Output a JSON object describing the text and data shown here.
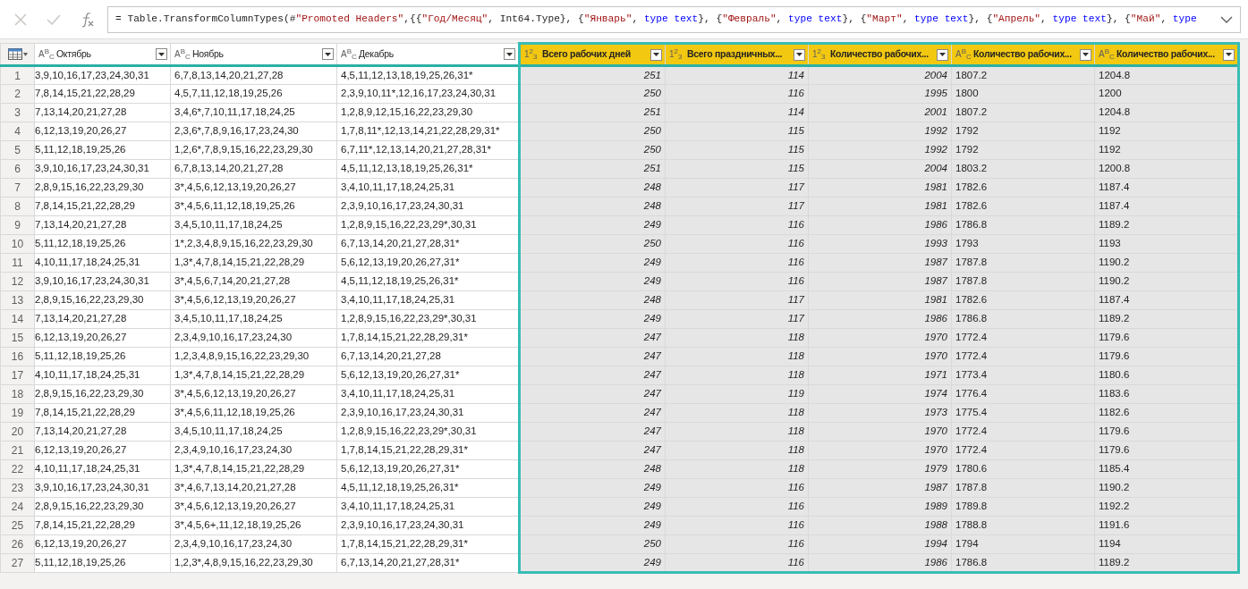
{
  "formula_bar": {
    "formula": [
      {
        "kind": "plain",
        "text": "= Table.TransformColumnTypes(#"
      },
      {
        "kind": "string",
        "text": "\"Promoted Headers\""
      },
      {
        "kind": "plain",
        "text": ",{{"
      },
      {
        "kind": "string",
        "text": "\"Год/Месяц\""
      },
      {
        "kind": "plain",
        "text": ", Int64.Type}, {"
      },
      {
        "kind": "string",
        "text": "\"Январь\""
      },
      {
        "kind": "plain",
        "text": ", "
      },
      {
        "kind": "keyword",
        "text": "type text"
      },
      {
        "kind": "plain",
        "text": "}, {"
      },
      {
        "kind": "string",
        "text": "\"Февраль\""
      },
      {
        "kind": "plain",
        "text": ", "
      },
      {
        "kind": "keyword",
        "text": "type text"
      },
      {
        "kind": "plain",
        "text": "}, {"
      },
      {
        "kind": "string",
        "text": "\"Март\""
      },
      {
        "kind": "plain",
        "text": ", "
      },
      {
        "kind": "keyword",
        "text": "type text"
      },
      {
        "kind": "plain",
        "text": "}, {"
      },
      {
        "kind": "string",
        "text": "\"Апрель\""
      },
      {
        "kind": "plain",
        "text": ", "
      },
      {
        "kind": "keyword",
        "text": "type text"
      },
      {
        "kind": "plain",
        "text": "}, {"
      },
      {
        "kind": "string",
        "text": "\"Май\""
      },
      {
        "kind": "plain",
        "text": ", "
      },
      {
        "kind": "keyword",
        "text": "type"
      }
    ]
  },
  "table": {
    "columns": [
      {
        "label": "Октябрь",
        "kind": "text",
        "type_label": "A$^{B}$$_{C}$",
        "selected": false
      },
      {
        "label": "Ноябрь",
        "kind": "text",
        "type_label": "A$^{B}$$_{C}$",
        "selected": false
      },
      {
        "label": "Декабрь",
        "kind": "text",
        "type_label": "A$^{B}$$_{C}$",
        "selected": false
      },
      {
        "label": "Всего рабочих дней",
        "kind": "number",
        "type_label": "1$^{2}$$_{3}$",
        "selected": true
      },
      {
        "label": "Всего праздничных...",
        "kind": "number",
        "type_label": "1$^{2}$$_{3}$",
        "selected": true
      },
      {
        "label": "Количество рабочих...",
        "kind": "number",
        "type_label": "1$^{2}$$_{3}$",
        "selected": true
      },
      {
        "label": "Количество рабочих...",
        "kind": "text",
        "type_label": "A$^{B}$$_{C}$",
        "selected": true
      },
      {
        "label": "Количество рабочих...",
        "kind": "text",
        "type_label": "A$^{B}$$_{C}$",
        "selected": true
      }
    ],
    "rows": [
      {
        "number": "1",
        "cells": [
          "3,9,10,16,17,23,24,30,31",
          "6,7,8,13,14,20,21,27,28",
          "4,5,11,12,13,18,19,25,26,31*",
          "251",
          "114",
          "2004",
          "1807.2",
          "1204.8"
        ]
      },
      {
        "number": "2",
        "cells": [
          "7,8,14,15,21,22,28,29",
          "4,5,7,11,12,18,19,25,26",
          "2,3,9,10,11*,12,16,17,23,24,30,31",
          "250",
          "116",
          "1995",
          "1800",
          "1200"
        ]
      },
      {
        "number": "3",
        "cells": [
          "7,13,14,20,21,27,28",
          "3,4,6*,7,10,11,17,18,24,25",
          "1,2,8,9,12,15,16,22,23,29,30",
          "251",
          "114",
          "2001",
          "1807.2",
          "1204.8"
        ]
      },
      {
        "number": "4",
        "cells": [
          "6,12,13,19,20,26,27",
          "2,3,6*,7,8,9,16,17,23,24,30",
          "1,7,8,11*,12,13,14,21,22,28,29,31*",
          "250",
          "115",
          "1992",
          "1792",
          "1192"
        ]
      },
      {
        "number": "5",
        "cells": [
          "5,11,12,18,19,25,26",
          "1,2,6*,7,8,9,15,16,22,23,29,30",
          "6,7,11*,12,13,14,20,21,27,28,31*",
          "250",
          "115",
          "1992",
          "1792",
          "1192"
        ]
      },
      {
        "number": "6",
        "cells": [
          "3,9,10,16,17,23,24,30,31",
          "6,7,8,13,14,20,21,27,28",
          "4,5,11,12,13,18,19,25,26,31*",
          "251",
          "115",
          "2004",
          "1803.2",
          "1200.8"
        ]
      },
      {
        "number": "7",
        "cells": [
          "2,8,9,15,16,22,23,29,30",
          "3*,4,5,6,12,13,19,20,26,27",
          "3,4,10,11,17,18,24,25,31",
          "248",
          "117",
          "1981",
          "1782.6",
          "1187.4"
        ]
      },
      {
        "number": "8",
        "cells": [
          "7,8,14,15,21,22,28,29",
          "3*,4,5,6,11,12,18,19,25,26",
          "2,3,9,10,16,17,23,24,30,31",
          "248",
          "117",
          "1981",
          "1782.6",
          "1187.4"
        ]
      },
      {
        "number": "9",
        "cells": [
          "7,13,14,20,21,27,28",
          "3,4,5,10,11,17,18,24,25",
          "1,2,8,9,15,16,22,23,29*,30,31",
          "249",
          "116",
          "1986",
          "1786.8",
          "1189.2"
        ]
      },
      {
        "number": "10",
        "cells": [
          "5,11,12,18,19,25,26",
          "1*,2,3,4,8,9,15,16,22,23,29,30",
          "6,7,13,14,20,21,27,28,31*",
          "250",
          "116",
          "1993",
          "1793",
          "1193"
        ]
      },
      {
        "number": "11",
        "cells": [
          "4,10,11,17,18,24,25,31",
          "1,3*,4,7,8,14,15,21,22,28,29",
          "5,6,12,13,19,20,26,27,31*",
          "249",
          "116",
          "1987",
          "1787.8",
          "1190.2"
        ]
      },
      {
        "number": "12",
        "cells": [
          "3,9,10,16,17,23,24,30,31",
          "3*,4,5,6,7,14,20,21,27,28",
          "4,5,11,12,18,19,25,26,31*",
          "249",
          "116",
          "1987",
          "1787.8",
          "1190.2"
        ]
      },
      {
        "number": "13",
        "cells": [
          "2,8,9,15,16,22,23,29,30",
          "3*,4,5,6,12,13,19,20,26,27",
          "3,4,10,11,17,18,24,25,31",
          "248",
          "117",
          "1981",
          "1782.6",
          "1187.4"
        ]
      },
      {
        "number": "14",
        "cells": [
          "7,13,14,20,21,27,28",
          "3,4,5,10,11,17,18,24,25",
          "1,2,8,9,15,16,22,23,29*,30,31",
          "249",
          "117",
          "1986",
          "1786.8",
          "1189.2"
        ]
      },
      {
        "number": "15",
        "cells": [
          "6,12,13,19,20,26,27",
          "2,3,4,9,10,16,17,23,24,30",
          "1,7,8,14,15,21,22,28,29,31*",
          "247",
          "118",
          "1970",
          "1772.4",
          "1179.6"
        ]
      },
      {
        "number": "16",
        "cells": [
          "5,11,12,18,19,25,26",
          "1,2,3,4,8,9,15,16,22,23,29,30",
          "6,7,13,14,20,21,27,28",
          "247",
          "118",
          "1970",
          "1772.4",
          "1179.6"
        ]
      },
      {
        "number": "17",
        "cells": [
          "4,10,11,17,18,24,25,31",
          "1,3*,4,7,8,14,15,21,22,28,29",
          "5,6,12,13,19,20,26,27,31*",
          "247",
          "118",
          "1971",
          "1773.4",
          "1180.6"
        ]
      },
      {
        "number": "18",
        "cells": [
          "2,8,9,15,16,22,23,29,30",
          "3*,4,5,6,12,13,19,20,26,27",
          "3,4,10,11,17,18,24,25,31",
          "247",
          "119",
          "1974",
          "1776.4",
          "1183.6"
        ]
      },
      {
        "number": "19",
        "cells": [
          "7,8,14,15,21,22,28,29",
          "3*,4,5,6,11,12,18,19,25,26",
          "2,3,9,10,16,17,23,24,30,31",
          "247",
          "118",
          "1973",
          "1775.4",
          "1182.6"
        ]
      },
      {
        "number": "20",
        "cells": [
          "7,13,14,20,21,27,28",
          "3,4,5,10,11,17,18,24,25",
          "1,2,8,9,15,16,22,23,29*,30,31",
          "247",
          "118",
          "1970",
          "1772.4",
          "1179.6"
        ]
      },
      {
        "number": "21",
        "cells": [
          "6,12,13,19,20,26,27",
          "2,3,4,9,10,16,17,23,24,30",
          "1,7,8,14,15,21,22,28,29,31*",
          "247",
          "118",
          "1970",
          "1772.4",
          "1179.6"
        ]
      },
      {
        "number": "22",
        "cells": [
          "4,10,11,17,18,24,25,31",
          "1,3*,4,7,8,14,15,21,22,28,29",
          "5,6,12,13,19,20,26,27,31*",
          "248",
          "118",
          "1979",
          "1780.6",
          "1185.4"
        ]
      },
      {
        "number": "23",
        "cells": [
          "3,9,10,16,17,23,24,30,31",
          "3*,4,6,7,13,14,20,21,27,28",
          "4,5,11,12,18,19,25,26,31*",
          "249",
          "116",
          "1987",
          "1787.8",
          "1190.2"
        ]
      },
      {
        "number": "24",
        "cells": [
          "2,8,9,15,16,22,23,29,30",
          "3*,4,5,6,12,13,19,20,26,27",
          "3,4,10,11,17,18,24,25,31",
          "249",
          "116",
          "1989",
          "1789.8",
          "1192.2"
        ]
      },
      {
        "number": "25",
        "cells": [
          "7,8,14,15,21,22,28,29",
          "3*,4,5,6+,11,12,18,19,25,26",
          "2,3,9,10,16,17,23,24,30,31",
          "249",
          "116",
          "1988",
          "1788.8",
          "1191.6"
        ]
      },
      {
        "number": "26",
        "cells": [
          "6,12,13,19,20,26,27",
          "2,3,4,9,10,16,17,23,24,30",
          "1,7,8,14,15,21,22,28,29,31*",
          "250",
          "116",
          "1994",
          "1794",
          "1194"
        ]
      },
      {
        "number": "27",
        "cells": [
          "5,11,12,18,19,25,26",
          "1,2,3*,4,8,9,15,16,22,23,29,30",
          "6,7,13,14,20,21,27,28,31*",
          "249",
          "116",
          "1986",
          "1786.8",
          "1189.2"
        ]
      }
    ]
  }
}
